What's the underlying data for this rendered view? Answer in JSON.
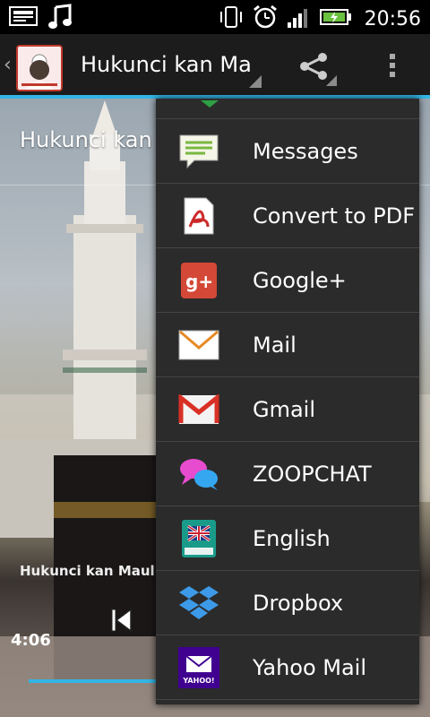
{
  "status_bar": {
    "time": "20:56",
    "icons": [
      "notification-icon",
      "music-note-icon",
      "vibrate-icon",
      "alarm-icon",
      "signal-icon",
      "battery-charging-icon"
    ]
  },
  "action_bar": {
    "title": "Hukunci kan Ma",
    "icons": [
      "back-chevron-icon",
      "app-avatar",
      "share-icon",
      "overflow-menu-icon"
    ]
  },
  "content": {
    "title": "Hukunci kan",
    "player_title": "Hukunci kan Maulid",
    "time": "4:06"
  },
  "share_menu": {
    "items": [
      {
        "label": "Messages",
        "icon": "messages-icon"
      },
      {
        "label": "Convert to PDF",
        "icon": "pdf-icon"
      },
      {
        "label": "Google+",
        "icon": "google-plus-icon"
      },
      {
        "label": "Mail",
        "icon": "mail-icon"
      },
      {
        "label": "Gmail",
        "icon": "gmail-icon"
      },
      {
        "label": "ZOOPCHAT",
        "icon": "chat-bubbles-icon"
      },
      {
        "label": "English",
        "icon": "dictionary-icon"
      },
      {
        "label": "Dropbox",
        "icon": "dropbox-icon"
      },
      {
        "label": "Yahoo Mail",
        "icon": "yahoo-mail-icon",
        "icon_text": "YAHOO!"
      }
    ]
  },
  "colors": {
    "accent": "#33b5e5",
    "menu_bg": "#2b2b2b",
    "battery": "#6ac13f"
  }
}
